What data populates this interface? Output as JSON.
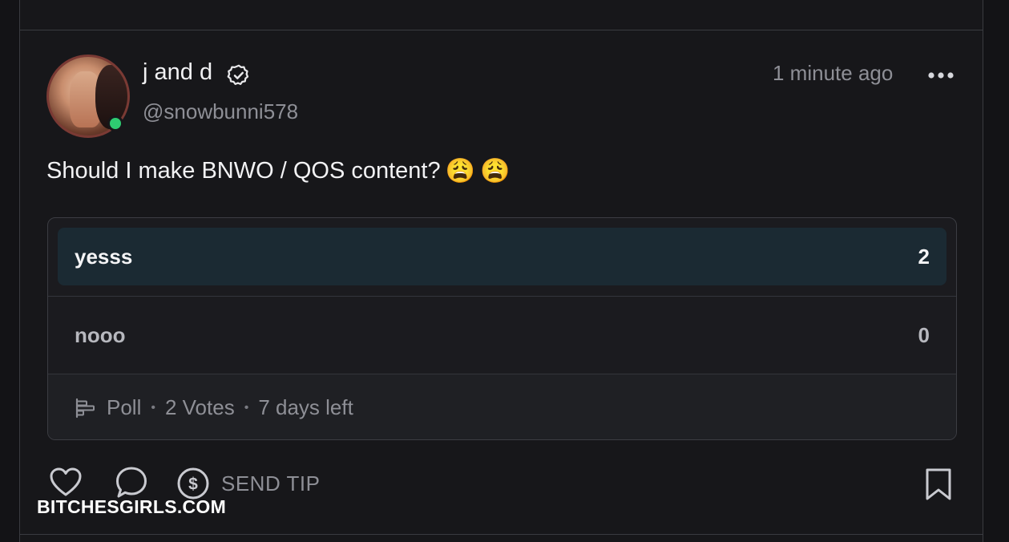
{
  "post": {
    "author": {
      "display_name": "j and d",
      "handle": "@snowbunni578",
      "verified": true,
      "online": true
    },
    "timestamp": "1 minute ago",
    "text": "Should I make BNWO / QOS content?",
    "emojis": [
      "😩",
      "😩"
    ]
  },
  "poll": {
    "options": [
      {
        "label": "yesss",
        "count": "2",
        "fraction": 1.0
      },
      {
        "label": "nooo",
        "count": "0",
        "fraction": 0.0
      }
    ],
    "footer": {
      "type": "Poll",
      "votes": "2 Votes",
      "remaining": "7 days left",
      "separator": "•"
    }
  },
  "actions": {
    "tip_label": "SEND TIP"
  },
  "watermark": "BITCHESGIRLS.COM",
  "colors": {
    "online": "#2ecc71",
    "poll_fill": "#1b2a33",
    "background": "#17171a"
  },
  "icons": [
    "verified-check-icon",
    "more-dots-icon",
    "poll-icon",
    "heart-icon",
    "comment-icon",
    "dollar-coin-icon",
    "bookmark-icon"
  ]
}
